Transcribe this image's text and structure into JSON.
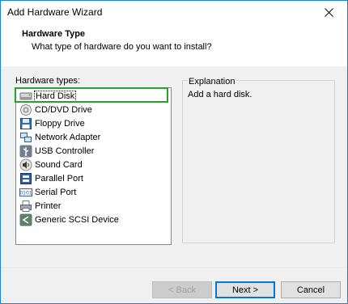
{
  "window": {
    "title": "Add Hardware Wizard"
  },
  "header": {
    "title": "Hardware Type",
    "subtitle": "What type of hardware do you want to install?"
  },
  "hardware_list": {
    "label": "Hardware types:",
    "items": [
      {
        "label": "Hard Disk",
        "icon": "hard-disk-icon",
        "selected": true
      },
      {
        "label": "CD/DVD Drive",
        "icon": "cd-dvd-icon"
      },
      {
        "label": "Floppy Drive",
        "icon": "floppy-icon"
      },
      {
        "label": "Network Adapter",
        "icon": "network-adapter-icon"
      },
      {
        "label": "USB Controller",
        "icon": "usb-icon"
      },
      {
        "label": "Sound Card",
        "icon": "sound-card-icon"
      },
      {
        "label": "Parallel Port",
        "icon": "parallel-port-icon"
      },
      {
        "label": "Serial Port",
        "icon": "serial-port-icon"
      },
      {
        "label": "Printer",
        "icon": "printer-icon"
      },
      {
        "label": "Generic SCSI Device",
        "icon": "scsi-device-icon"
      }
    ]
  },
  "explanation": {
    "title": "Explanation",
    "text": "Add a hard disk."
  },
  "buttons": {
    "back": "< Back",
    "next": "Next >",
    "cancel": "Cancel"
  },
  "colors": {
    "accent": "#0078d7",
    "selection_highlight": "#22a32b",
    "window_border": "#1883d7"
  }
}
